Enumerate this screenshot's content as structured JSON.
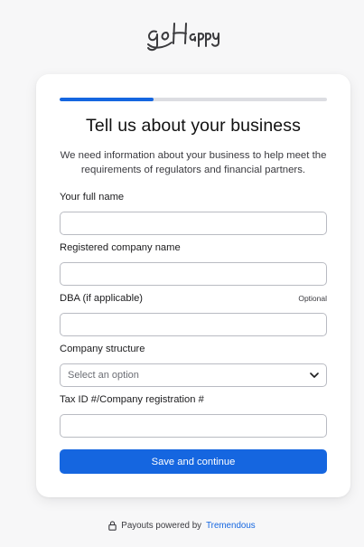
{
  "brand": {
    "logo_text": "goHappy"
  },
  "form": {
    "progress": 0.35,
    "title": "Tell us about your business",
    "subtitle": "We need information about your business to help meet the requirements of regulators and financial partners.",
    "fields": {
      "full_name": {
        "label": "Your full name",
        "value": ""
      },
      "company_name": {
        "label": "Registered company name",
        "value": ""
      },
      "dba": {
        "label": "DBA (if applicable)",
        "optional_label": "Optional",
        "value": ""
      },
      "company_structure": {
        "label": "Company structure",
        "placeholder": "Select an option"
      },
      "tax_id": {
        "label": "Tax ID #/Company registration #",
        "value": ""
      }
    },
    "submit_label": "Save and continue"
  },
  "footer": {
    "text": "Payouts powered by",
    "link_text": "Tremendous"
  },
  "colors": {
    "accent": "#1566e0",
    "progress_track": "#dcdde2",
    "background": "#f7f7f8"
  }
}
